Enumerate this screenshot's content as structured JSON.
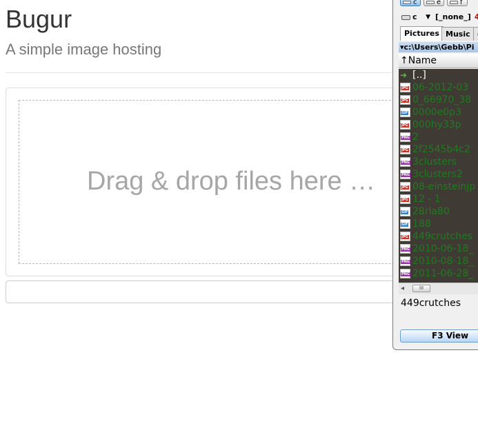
{
  "site": {
    "title": "Bugur",
    "subtitle": "A simple image hosting"
  },
  "dropzone": {
    "text": "Drag & drop files here …"
  },
  "url_field": {
    "value": ""
  },
  "file_manager": {
    "drive_buttons": [
      "c",
      "e",
      "f"
    ],
    "active_drive_button": "c",
    "drive_select": "c",
    "drive_label": "[_none_]",
    "drive_free": "4",
    "tabs": [
      "Pictures",
      "Music",
      "c"
    ],
    "active_tab": "Pictures",
    "path": "▾c:\\Users\\Gebb\\Pi",
    "column_header": "Name",
    "sort_arrow": "↑",
    "parent_entry": "[..]",
    "files": [
      {
        "name": "06-2012-03",
        "type": "JPG"
      },
      {
        "name": "0_66970_38",
        "type": "JPG"
      },
      {
        "name": "0000e0p3",
        "type": "GIF"
      },
      {
        "name": "000hy33p",
        "type": "JPG"
      },
      {
        "name": "2",
        "type": "PNG"
      },
      {
        "name": "2f2545b4c2",
        "type": "JPG"
      },
      {
        "name": "3clusters",
        "type": "PNG"
      },
      {
        "name": "3clusters2",
        "type": "PNG"
      },
      {
        "name": "08-einsteinjp",
        "type": "JPG"
      },
      {
        "name": "12 - 1",
        "type": "JPG"
      },
      {
        "name": "28rla80",
        "type": "GIF"
      },
      {
        "name": "188",
        "type": "GIF"
      },
      {
        "name": "449crutches",
        "type": "JPG"
      },
      {
        "name": "2010-06-18_",
        "type": "PNG"
      },
      {
        "name": "2010-08-18_",
        "type": "PNG"
      },
      {
        "name": "2011-06-28_",
        "type": "PNG"
      }
    ],
    "scroll_grip": "III",
    "status": "449crutches",
    "f3_button": "F3 View",
    "colors": {
      "JPG": "#d42b1e",
      "GIF": "#2f7fcf",
      "PNG": "#9b2fae",
      "file_text": "#1f7a1f",
      "list_bg": "#3f3b34"
    }
  }
}
